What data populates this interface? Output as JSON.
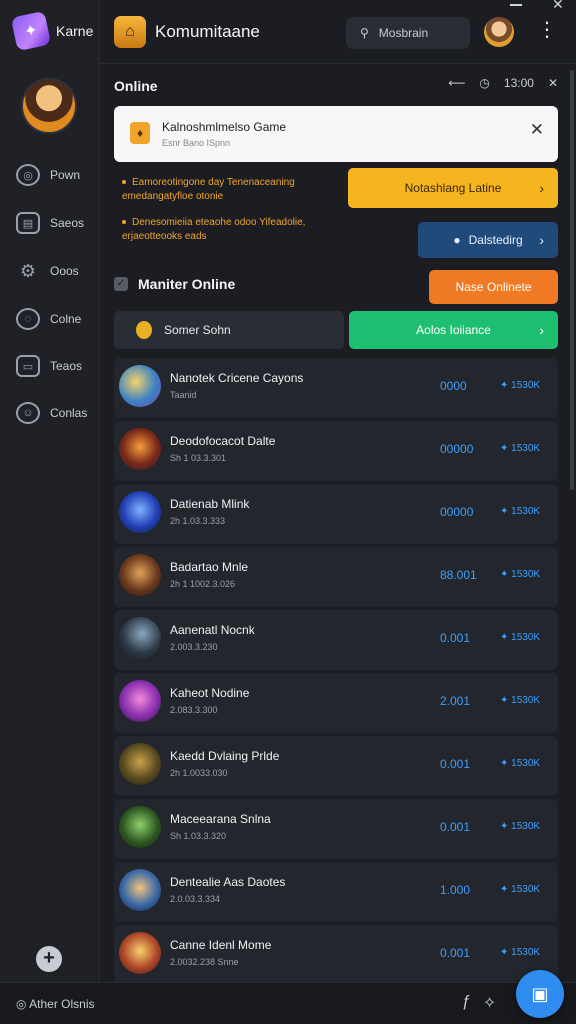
{
  "brand": {
    "name": "Karne"
  },
  "sidebar": {
    "items": [
      {
        "label": "Pown",
        "icon": "pown-icon"
      },
      {
        "label": "Saeos",
        "icon": "sheets-icon"
      },
      {
        "label": "Ooos",
        "icon": "gamepad-icon"
      },
      {
        "label": "Colne",
        "icon": "chat-icon"
      },
      {
        "label": "Teaos",
        "icon": "calendar-icon"
      },
      {
        "label": "Conlas",
        "icon": "contacts-icon"
      }
    ]
  },
  "topbar": {
    "title": "Komumitaane",
    "search_text": "Mosbrain"
  },
  "main": {
    "section_title": "Online",
    "time": "13:00",
    "notice": {
      "title": "Kalnoshmlmelso Game",
      "subtitle": "Esnr Bano ISpnn"
    },
    "bullets": [
      "Eamoreotingone day Tenenaceaning emedangatyfloe otonie",
      "Denesomieiia eteaohe odoo Yifeadolie, erjaeotteooks eads"
    ],
    "buttons": {
      "yellow": "Notashlang Latine",
      "blue": "Dalstedirg",
      "orange": "Nase Onlinete",
      "green": "Aolos Ioiiance"
    },
    "monitor_title": "Maniter Online",
    "search_game": "Somer Sohn"
  },
  "list": [
    {
      "title": "Nanotek Cricene Cayons",
      "sub": "Taanid",
      "value": "0000",
      "rate": "1530K"
    },
    {
      "title": "Deodofocacot Dalte",
      "sub": "Sh 1 03.3.301",
      "value": "00000",
      "rate": "1530K"
    },
    {
      "title": "Datienab Mlink",
      "sub": "2h 1.03.3.333",
      "value": "00000",
      "rate": "1530K"
    },
    {
      "title": "Badartao Mnle",
      "sub": "2h 1 1002.3.026",
      "value": "88.001",
      "rate": "1530K"
    },
    {
      "title": "Aanenatl Nocnk",
      "sub": "2.003.3.230",
      "value": "0.001",
      "rate": "1530K"
    },
    {
      "title": "Kaheot Nodine",
      "sub": "2.083.3.300",
      "value": "2.001",
      "rate": "1530K"
    },
    {
      "title": "Kaedd Dvlaing Prlde",
      "sub": "2h 1.0033.030",
      "value": "0.001",
      "rate": "1530K"
    },
    {
      "title": "Maceearana Snlna",
      "sub": "Sh 1.03.3.320",
      "value": "0.001",
      "rate": "1530K"
    },
    {
      "title": "Dentealie Aas Daotes",
      "sub": "2.0.03.3.334",
      "value": "1.000",
      "rate": "1530K"
    },
    {
      "title": "Canne Idenl Mome",
      "sub": "2.0032.238 Snne",
      "value": "0.001",
      "rate": "1530K"
    }
  ],
  "bottombar": {
    "left_text": "Ather Olsnis"
  },
  "colors": {
    "accent_blue": "#3aa0ff",
    "yellow": "#f5b51f",
    "green": "#1fbf72",
    "orange": "#f07a24"
  }
}
